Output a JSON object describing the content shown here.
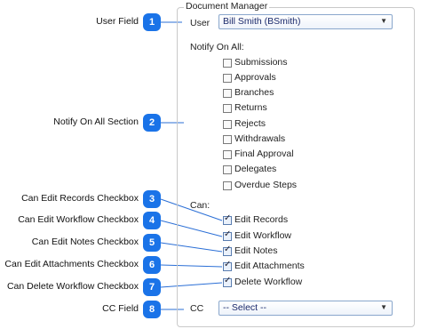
{
  "annotations": [
    {
      "label": "User Field",
      "number": "1"
    },
    {
      "label": "Notify On All Section",
      "number": "2"
    },
    {
      "label": "Can Edit Records Checkbox",
      "number": "3"
    },
    {
      "label": "Can Edit Workflow Checkbox",
      "number": "4"
    },
    {
      "label": "Can Edit Notes Checkbox",
      "number": "5"
    },
    {
      "label": "Can Edit Attachments Checkbox",
      "number": "6"
    },
    {
      "label": "Can Delete Workflow Checkbox",
      "number": "7"
    },
    {
      "label": "CC Field",
      "number": "8"
    }
  ],
  "panel": {
    "title": "Document Manager",
    "user_label": "User",
    "user_value": "Bill Smith (BSmith)",
    "notify_label": "Notify On All:",
    "notify_items": [
      "Submissions",
      "Approvals",
      "Branches",
      "Returns",
      "Rejects",
      "Withdrawals",
      "Final Approval",
      "Delegates",
      "Overdue Steps"
    ],
    "can_label": "Can:",
    "can_items": [
      "Edit Records",
      "Edit Workflow",
      "Edit Notes",
      "Edit Attachments",
      "Delete Workflow"
    ],
    "cc_label": "CC",
    "cc_value": "-- Select --"
  },
  "colors": {
    "badge": "#1a73e8",
    "leader": "#2b6fd6"
  }
}
